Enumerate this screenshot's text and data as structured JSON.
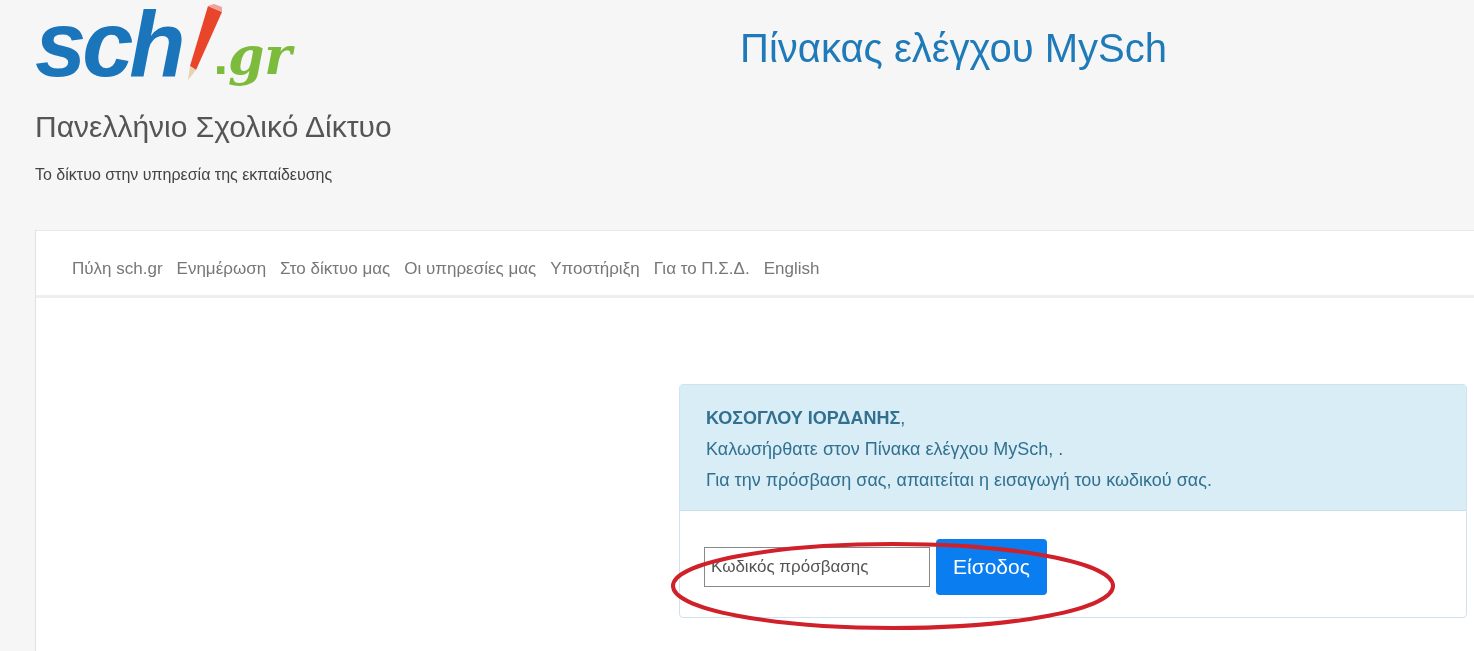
{
  "logo": {
    "main": "sch",
    "dot": ".",
    "suffix": "gr",
    "name": "Πανελλήνιο Σχολικό Δίκτυο",
    "tagline": "Το δίκτυο στην υπηρεσία της εκπαίδευσης"
  },
  "title": "Πίνακας ελέγχου MySch",
  "nav": [
    {
      "label": "Πύλη sch.gr"
    },
    {
      "label": "Ενημέρωση"
    },
    {
      "label": "Στο δίκτυο μας"
    },
    {
      "label": "Οι υπηρεσίες μας"
    },
    {
      "label": "Υποστήριξη"
    },
    {
      "label": "Για το Π.Σ.Δ."
    },
    {
      "label": "English"
    }
  ],
  "login_card": {
    "user_name": "**ΚΟΣΟΓΛΟΥ ΙΟΡΔΑΝΗΣ**,",
    "welcome": "Καλωσήρθατε στον Πίνακα ελέγχου MySch, .",
    "instruction": "Για την πρόσβαση σας, απαιτείται η εισαγωγή του κωδικού σας.",
    "password": {
      "placeholder": "Κωδικός πρόσβασης"
    },
    "submit": "Είσοδος",
    "highlighted": true
  }
}
